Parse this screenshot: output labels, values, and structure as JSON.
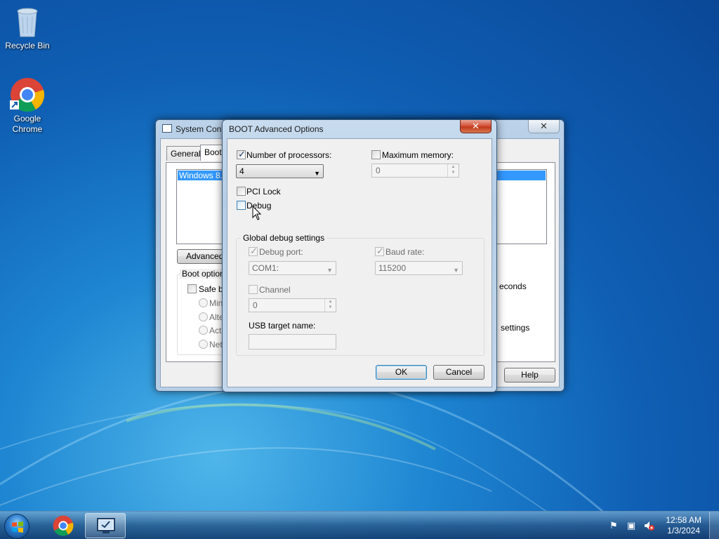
{
  "desktop": {
    "icons": [
      {
        "label": "Recycle Bin",
        "icon": "recycle-bin-icon"
      },
      {
        "label": "Google Chrome",
        "icon": "chrome-icon"
      }
    ]
  },
  "system_config": {
    "title": "System Conf",
    "tabs": [
      "General",
      "Boot"
    ],
    "os_list_item": "Windows 8.1",
    "advanced_button": "Advanced o",
    "boot_options_group": "Boot options",
    "safe_boot_label": "Safe bo",
    "radio_labels": [
      "Mini",
      "Alter",
      "Activ",
      "Netv"
    ],
    "timeout_suffix": "econds",
    "settings_suffix": "settings",
    "help_button": "Help",
    "close_glyph": "✕"
  },
  "boot_advanced": {
    "title": "BOOT Advanced Options",
    "close_glyph": "✕",
    "num_processors": {
      "label": "Number of processors:",
      "checked": true,
      "value": "4"
    },
    "max_memory": {
      "label": "Maximum memory:",
      "checked": false,
      "value": "0"
    },
    "pci_lock": {
      "label": "PCI Lock",
      "checked": false
    },
    "debug": {
      "label": "Debug",
      "checked": false
    },
    "global_debug": {
      "title": "Global debug settings",
      "debug_port": {
        "label": "Debug port:",
        "checked": true,
        "value": "COM1:"
      },
      "baud_rate": {
        "label": "Baud rate:",
        "checked": true,
        "value": "115200"
      },
      "channel": {
        "label": "Channel",
        "checked": false,
        "value": "0"
      },
      "usb_target": {
        "label": "USB target name:",
        "value": ""
      }
    },
    "ok_button": "OK",
    "cancel_button": "Cancel"
  },
  "taskbar": {
    "start": "start-orb-icon",
    "items": [
      "chrome-icon",
      "msconfig-icon"
    ],
    "clock_time": "12:58 AM",
    "clock_date": "1/3/2024",
    "tray_icons": [
      "action-center-flag-icon",
      "network-icon",
      "volume-muted-icon"
    ]
  },
  "colors": {
    "selection": "#3399ff",
    "accent": "#3c7fb1"
  }
}
